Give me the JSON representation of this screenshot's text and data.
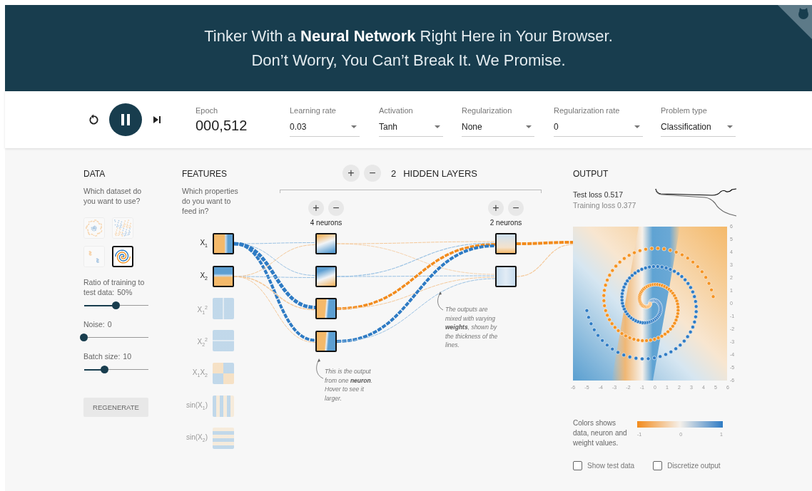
{
  "header": {
    "lines": [
      "Tinker With a **Neural Network** Right Here in Your Browser.",
      "Don’t Worry, You Can’t Break It. We Promise."
    ]
  },
  "controls": {
    "playing": true,
    "epoch": {
      "label": "Epoch",
      "value": "000,512"
    },
    "dropdowns": [
      {
        "label": "Learning rate",
        "value": "0.03"
      },
      {
        "label": "Activation",
        "value": "Tanh"
      },
      {
        "label": "Regularization",
        "value": "None"
      },
      {
        "label": "Regularization rate",
        "value": "0"
      },
      {
        "label": "Problem type",
        "value": "Classification"
      }
    ]
  },
  "data": {
    "heading": "DATA",
    "prompt": "Which dataset do you want to use?",
    "datasets": [
      {
        "kind": "circle",
        "selected": false
      },
      {
        "kind": "xor",
        "selected": false
      },
      {
        "kind": "gauss",
        "selected": false
      },
      {
        "kind": "spiral",
        "selected": true
      }
    ],
    "sliders": [
      {
        "label": "Ratio of training to test data:",
        "value": "50%",
        "level": 0.5
      },
      {
        "label": "Noise:",
        "value": "0",
        "level": 0
      },
      {
        "label": "Batch size:",
        "value": "10",
        "level": 0.32
      }
    ],
    "button": "REGENERATE"
  },
  "features": {
    "heading": "FEATURES",
    "prompt": "Which properties do you want to feed in?",
    "items": [
      {
        "label": "X$_{1}$",
        "kind": "x1",
        "on": true
      },
      {
        "label": "X$_{2}$",
        "kind": "x2",
        "on": true
      },
      {
        "label": "X$_{1}$$^{2}$",
        "kind": "x1sq",
        "on": false
      },
      {
        "label": "X$_{2}$$^{2}$",
        "kind": "x2sq",
        "on": false
      },
      {
        "label": "X$_{1}$X$_{2}$",
        "kind": "x1x2",
        "on": false
      },
      {
        "label": "sin(X$_{1}$)",
        "kind": "sin1",
        "on": false
      },
      {
        "label": "sin(X$_{2}$)",
        "kind": "sin2",
        "on": false
      }
    ]
  },
  "network": {
    "add": "+",
    "remove": "−",
    "count": "2",
    "title": "HIDDEN LAYERS",
    "layers": [
      {
        "add": "+",
        "remove": "−",
        "label": "4 neurons"
      },
      {
        "add": "+",
        "remove": "−",
        "label": "2 neurons"
      }
    ],
    "notes": [
      "This is the output from one **neuron**. Hover to see it larger.",
      "The outputs are mixed with varying **weights**, shown by the thickness of the lines."
    ]
  },
  "output": {
    "heading": "OUTPUT",
    "test_loss": "Test loss 0.517",
    "training_loss": "Training loss 0.377",
    "y_ticks": [
      "6",
      "5",
      "4",
      "3",
      "2",
      "1",
      "0",
      "-1",
      "-2",
      "-3",
      "-4",
      "-5",
      "-6"
    ],
    "x_ticks": [
      "-6",
      "-5",
      "-4",
      "-3",
      "-2",
      "-1",
      "0",
      "1",
      "2",
      "3",
      "4",
      "5",
      "6"
    ],
    "legend": {
      "text": "Colors shows data, neuron and weight values.",
      "ticks": [
        "-1",
        "0",
        "1"
      ]
    },
    "checkboxes": [
      {
        "label": "Show test data",
        "checked": false
      },
      {
        "label": "Discretize output",
        "checked": false
      }
    ]
  }
}
